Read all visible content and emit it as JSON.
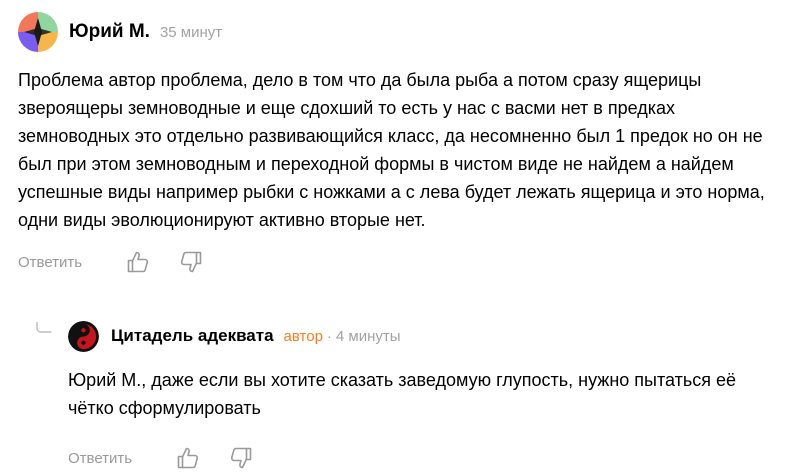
{
  "comments": [
    {
      "author": "Юрий М.",
      "time": "35 минут",
      "text": "Проблема автор проблема, дело в том что да была рыба а потом сразу ящерицы звероящеры земноводные и еще сдохший то есть у нас с васми нет в предках земноводных это отдельно развивающийся класс, да несомненно был 1 предок но он не был при этом земноводным и переходной формы в чистом виде не найдем а найдем успешные виды например рыбки с ножками а с лева будет лежать ящерица и это норма, одни виды эволюционируют активно вторые нет.",
      "reply_label": "Ответить",
      "avatar_colors": [
        "#f2765a",
        "#8fd6a0",
        "#7b5cf0",
        "#f5b74a"
      ]
    },
    {
      "author": "Цитадель адеквата",
      "badge": "автор",
      "separator": "·",
      "time": "4 минуты",
      "text": "Юрий М., даже если вы хотите сказать заведомую глупость, нужно пытаться её чётко сформулировать",
      "reply_label": "Ответить",
      "avatar_colors": [
        "#111111",
        "#c4161c"
      ]
    }
  ],
  "icons": {
    "like": "thumb-up-icon",
    "dislike": "thumb-down-icon",
    "reply_arrow": "reply-arrow-icon"
  }
}
